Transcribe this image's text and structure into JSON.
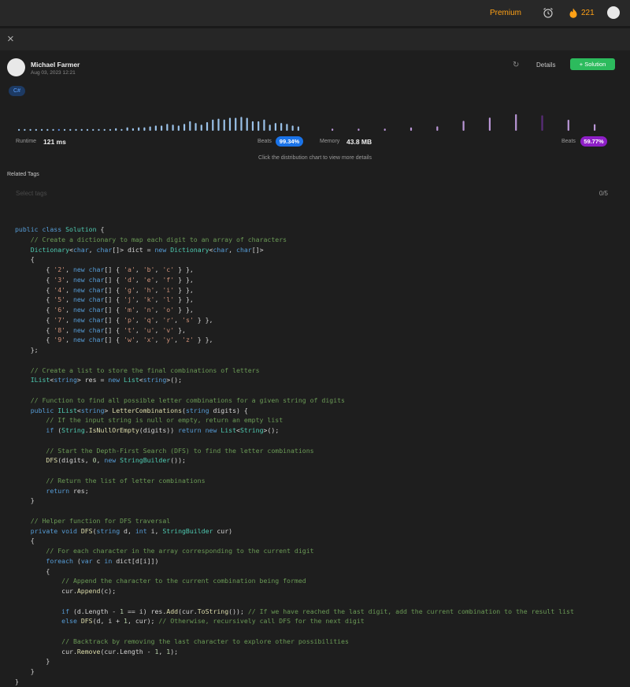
{
  "topbar": {
    "premium_label": "Premium",
    "streak_count": "221"
  },
  "author": {
    "name": "Michael Farmer",
    "date": "Aug 03, 2023 12:21"
  },
  "actions": {
    "details_label": "Details",
    "solution_label": "Solution"
  },
  "language_tag": "C#",
  "runtime": {
    "label": "Runtime",
    "value": "121 ms",
    "beats_label": "Beats",
    "beats_value": "99.34%"
  },
  "memory": {
    "label": "Memory",
    "value": "43.8 MB",
    "beats_label": "Beats",
    "beats_value": "59.77%"
  },
  "chart_hint": "Click the distribution chart to view more details",
  "related_tags": {
    "label": "Related Tags",
    "placeholder": "Select tags",
    "count": "0/5"
  },
  "colors": {
    "accent_orange": "#ffa116",
    "success_green": "#2cbb5d",
    "runtime_blue": "#1a73e8",
    "memory_purple": "#8e1fc7",
    "runtime_bar": "#9ac1e8",
    "memory_bar": "#b996d6"
  },
  "icons": [
    "close-icon",
    "alarm-clock-icon",
    "flame-icon",
    "refresh-icon",
    "plus-icon"
  ],
  "chart_data": [
    {
      "type": "bar",
      "series": [
        {
          "name": "Runtime",
          "values": [
            0.1,
            0.1,
            0.1,
            0.1,
            0.1,
            0.1,
            0.1,
            0.1,
            0.1,
            0.1,
            0.1,
            0.1,
            0.1,
            0.1,
            0.1,
            0.1,
            0.1,
            0.15,
            0.1,
            0.2,
            0.15,
            0.2,
            0.2,
            0.25,
            0.3,
            0.3,
            0.4,
            0.35,
            0.3,
            0.4,
            0.55,
            0.45,
            0.35,
            0.5,
            0.65,
            0.7,
            0.65,
            0.75,
            0.75,
            0.8,
            0.75,
            0.55,
            0.55,
            0.65,
            0.35,
            0.45,
            0.45,
            0.4,
            0.3,
            0.25
          ]
        }
      ],
      "highlight_index": 7
    },
    {
      "type": "bar",
      "series": [
        {
          "name": "Memory",
          "values": [
            0.1,
            0.1,
            0.1,
            0.15,
            0.2,
            0.45,
            0.6,
            0.75,
            0.7,
            0.5,
            0.3
          ]
        }
      ],
      "highlight_index": 8
    }
  ],
  "code_lines": [
    [
      [
        "k",
        "public class "
      ],
      [
        "t",
        "Solution"
      ],
      [
        "v",
        " {"
      ]
    ],
    [
      [
        "c",
        "    // Create a dictionary to map each digit to an array of characters"
      ]
    ],
    [
      [
        "t",
        "    Dictionary"
      ],
      [
        "v",
        "<"
      ],
      [
        "k",
        "char"
      ],
      [
        "v",
        ", "
      ],
      [
        "k",
        "char"
      ],
      [
        "v",
        "[]> dict = "
      ],
      [
        "k",
        "new "
      ],
      [
        "t",
        "Dictionary"
      ],
      [
        "v",
        "<"
      ],
      [
        "k",
        "char"
      ],
      [
        "v",
        ", "
      ],
      [
        "k",
        "char"
      ],
      [
        "v",
        "[]>"
      ]
    ],
    [
      [
        "v",
        "    {"
      ]
    ],
    [
      [
        "v",
        "        { "
      ],
      [
        "s",
        "'2'"
      ],
      [
        "v",
        ", "
      ],
      [
        "k",
        "new char"
      ],
      [
        "v",
        "[] { "
      ],
      [
        "s",
        "'a'"
      ],
      [
        "v",
        ", "
      ],
      [
        "s",
        "'b'"
      ],
      [
        "v",
        ", "
      ],
      [
        "s",
        "'c'"
      ],
      [
        "v",
        " } },"
      ]
    ],
    [
      [
        "v",
        "        { "
      ],
      [
        "s",
        "'3'"
      ],
      [
        "v",
        ", "
      ],
      [
        "k",
        "new char"
      ],
      [
        "v",
        "[] { "
      ],
      [
        "s",
        "'d'"
      ],
      [
        "v",
        ", "
      ],
      [
        "s",
        "'e'"
      ],
      [
        "v",
        ", "
      ],
      [
        "s",
        "'f'"
      ],
      [
        "v",
        " } },"
      ]
    ],
    [
      [
        "v",
        "        { "
      ],
      [
        "s",
        "'4'"
      ],
      [
        "v",
        ", "
      ],
      [
        "k",
        "new char"
      ],
      [
        "v",
        "[] { "
      ],
      [
        "s",
        "'g'"
      ],
      [
        "v",
        ", "
      ],
      [
        "s",
        "'h'"
      ],
      [
        "v",
        ", "
      ],
      [
        "s",
        "'i'"
      ],
      [
        "v",
        " } },"
      ]
    ],
    [
      [
        "v",
        "        { "
      ],
      [
        "s",
        "'5'"
      ],
      [
        "v",
        ", "
      ],
      [
        "k",
        "new char"
      ],
      [
        "v",
        "[] { "
      ],
      [
        "s",
        "'j'"
      ],
      [
        "v",
        ", "
      ],
      [
        "s",
        "'k'"
      ],
      [
        "v",
        ", "
      ],
      [
        "s",
        "'l'"
      ],
      [
        "v",
        " } },"
      ]
    ],
    [
      [
        "v",
        "        { "
      ],
      [
        "s",
        "'6'"
      ],
      [
        "v",
        ", "
      ],
      [
        "k",
        "new char"
      ],
      [
        "v",
        "[] { "
      ],
      [
        "s",
        "'m'"
      ],
      [
        "v",
        ", "
      ],
      [
        "s",
        "'n'"
      ],
      [
        "v",
        ", "
      ],
      [
        "s",
        "'o'"
      ],
      [
        "v",
        " } },"
      ]
    ],
    [
      [
        "v",
        "        { "
      ],
      [
        "s",
        "'7'"
      ],
      [
        "v",
        ", "
      ],
      [
        "k",
        "new char"
      ],
      [
        "v",
        "[] { "
      ],
      [
        "s",
        "'p'"
      ],
      [
        "v",
        ", "
      ],
      [
        "s",
        "'q'"
      ],
      [
        "v",
        ", "
      ],
      [
        "s",
        "'r'"
      ],
      [
        "v",
        ", "
      ],
      [
        "s",
        "'s'"
      ],
      [
        "v",
        " } },"
      ]
    ],
    [
      [
        "v",
        "        { "
      ],
      [
        "s",
        "'8'"
      ],
      [
        "v",
        ", "
      ],
      [
        "k",
        "new char"
      ],
      [
        "v",
        "[] { "
      ],
      [
        "s",
        "'t'"
      ],
      [
        "v",
        ", "
      ],
      [
        "s",
        "'u'"
      ],
      [
        "v",
        ", "
      ],
      [
        "s",
        "'v'"
      ],
      [
        "v",
        " },"
      ]
    ],
    [
      [
        "v",
        "        { "
      ],
      [
        "s",
        "'9'"
      ],
      [
        "v",
        ", "
      ],
      [
        "k",
        "new char"
      ],
      [
        "v",
        "[] { "
      ],
      [
        "s",
        "'w'"
      ],
      [
        "v",
        ", "
      ],
      [
        "s",
        "'x'"
      ],
      [
        "v",
        ", "
      ],
      [
        "s",
        "'y'"
      ],
      [
        "v",
        ", "
      ],
      [
        "s",
        "'z'"
      ],
      [
        "v",
        " } },"
      ]
    ],
    [
      [
        "v",
        "    };"
      ]
    ],
    [
      [
        "v",
        ""
      ]
    ],
    [
      [
        "c",
        "    // Create a list to store the final combinations of letters"
      ]
    ],
    [
      [
        "t",
        "    IList"
      ],
      [
        "v",
        "<"
      ],
      [
        "k",
        "string"
      ],
      [
        "v",
        "> res = "
      ],
      [
        "k",
        "new "
      ],
      [
        "t",
        "List"
      ],
      [
        "v",
        "<"
      ],
      [
        "k",
        "string"
      ],
      [
        "v",
        ">();"
      ]
    ],
    [
      [
        "v",
        ""
      ]
    ],
    [
      [
        "c",
        "    // Function to find all possible letter combinations for a given string of digits"
      ]
    ],
    [
      [
        "k",
        "    public "
      ],
      [
        "t",
        "IList"
      ],
      [
        "v",
        "<"
      ],
      [
        "k",
        "string"
      ],
      [
        "v",
        "> "
      ],
      [
        "f",
        "LetterCombinations"
      ],
      [
        "v",
        "("
      ],
      [
        "k",
        "string"
      ],
      [
        "v",
        " digits) {"
      ]
    ],
    [
      [
        "c",
        "        // If the input string is null or empty, return an empty list"
      ]
    ],
    [
      [
        "k",
        "        if "
      ],
      [
        "v",
        "("
      ],
      [
        "t",
        "String"
      ],
      [
        "v",
        "."
      ],
      [
        "f",
        "IsNullOrEmpty"
      ],
      [
        "v",
        "(digits)) "
      ],
      [
        "k",
        "return new "
      ],
      [
        "t",
        "List"
      ],
      [
        "v",
        "<"
      ],
      [
        "t",
        "String"
      ],
      [
        "v",
        ">();"
      ]
    ],
    [
      [
        "v",
        ""
      ]
    ],
    [
      [
        "c",
        "        // Start the Depth-First Search (DFS) to find the letter combinations"
      ]
    ],
    [
      [
        "f",
        "        DFS"
      ],
      [
        "v",
        "(digits, "
      ],
      [
        "n",
        "0"
      ],
      [
        "v",
        ", "
      ],
      [
        "k",
        "new "
      ],
      [
        "t",
        "StringBuilder"
      ],
      [
        "v",
        "());"
      ]
    ],
    [
      [
        "v",
        ""
      ]
    ],
    [
      [
        "c",
        "        // Return the list of letter combinations"
      ]
    ],
    [
      [
        "k",
        "        return "
      ],
      [
        "v",
        "res;"
      ]
    ],
    [
      [
        "v",
        "    }"
      ]
    ],
    [
      [
        "v",
        ""
      ]
    ],
    [
      [
        "c",
        "    // Helper function for DFS traversal"
      ]
    ],
    [
      [
        "k",
        "    private void "
      ],
      [
        "f",
        "DFS"
      ],
      [
        "v",
        "("
      ],
      [
        "k",
        "string"
      ],
      [
        "v",
        " d, "
      ],
      [
        "k",
        "int"
      ],
      [
        "v",
        " i, "
      ],
      [
        "t",
        "StringBuilder"
      ],
      [
        "v",
        " cur)"
      ]
    ],
    [
      [
        "v",
        "    {"
      ]
    ],
    [
      [
        "c",
        "        // For each character in the array corresponding to the current digit"
      ]
    ],
    [
      [
        "k",
        "        foreach "
      ],
      [
        "v",
        "("
      ],
      [
        "k",
        "var"
      ],
      [
        "v",
        " c "
      ],
      [
        "k",
        "in"
      ],
      [
        "v",
        " dict[d[i]])"
      ]
    ],
    [
      [
        "v",
        "        {"
      ]
    ],
    [
      [
        "c",
        "            // Append the character to the current combination being formed"
      ]
    ],
    [
      [
        "v",
        "            cur."
      ],
      [
        "f",
        "Append"
      ],
      [
        "v",
        "(c);"
      ]
    ],
    [
      [
        "v",
        ""
      ]
    ],
    [
      [
        "k",
        "            if "
      ],
      [
        "v",
        "(d.Length - "
      ],
      [
        "n",
        "1"
      ],
      [
        "v",
        " == i) res."
      ],
      [
        "f",
        "Add"
      ],
      [
        "v",
        "(cur."
      ],
      [
        "f",
        "ToString"
      ],
      [
        "v",
        "()); "
      ],
      [
        "c",
        "// If we have reached the last digit, add the current combination to the result list"
      ]
    ],
    [
      [
        "k",
        "            else "
      ],
      [
        "f",
        "DFS"
      ],
      [
        "v",
        "(d, i + "
      ],
      [
        "n",
        "1"
      ],
      [
        "v",
        ", cur); "
      ],
      [
        "c",
        "// Otherwise, recursively call DFS for the next digit"
      ]
    ],
    [
      [
        "v",
        ""
      ]
    ],
    [
      [
        "c",
        "            // Backtrack by removing the last character to explore other possibilities"
      ]
    ],
    [
      [
        "v",
        "            cur."
      ],
      [
        "f",
        "Remove"
      ],
      [
        "v",
        "(cur.Length - "
      ],
      [
        "n",
        "1"
      ],
      [
        "v",
        ", "
      ],
      [
        "n",
        "1"
      ],
      [
        "v",
        ");"
      ]
    ],
    [
      [
        "v",
        "        }"
      ]
    ],
    [
      [
        "v",
        "    }"
      ]
    ],
    [
      [
        "v",
        "}"
      ]
    ]
  ]
}
